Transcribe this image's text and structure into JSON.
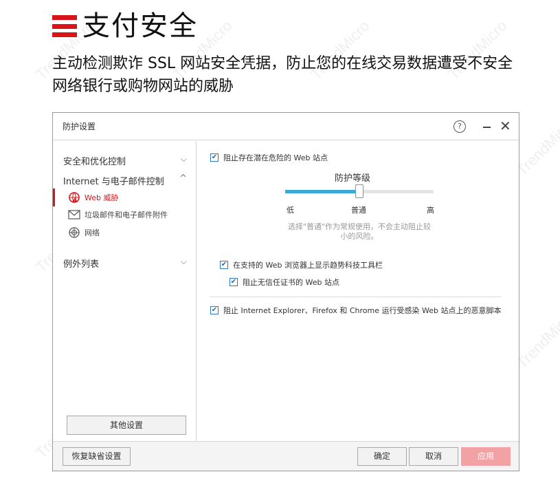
{
  "hero": {
    "title": "支付安全",
    "subtitle": "主动检测欺诈 SSL 网站安全凭据，防止您的在线交易数据遭受不安全网络银行或购物网站的威胁"
  },
  "watermark": "TrendMicro",
  "dialog": {
    "title": "防护设置",
    "help_icon": "?",
    "minimize_icon": "minimize-icon",
    "close_glyph": "✕"
  },
  "sidebar": {
    "security": "安全和优化控制",
    "internet_email": "Internet 与电子邮件控制",
    "web_threats": "Web 威胁",
    "spam": "垃圾邮件和电子邮件附件",
    "network": "网络",
    "exceptions": "例外列表",
    "other_settings": "其他设置",
    "chev_down": "⌵",
    "chev_up": "^"
  },
  "main": {
    "block_dangerous": "阻止存在潜在危险的 Web 站点",
    "level_title": "防护等级",
    "level_value_percent": 50,
    "level_low": "低",
    "level_normal": "普通",
    "level_high": "高",
    "level_desc": "选择\"普通\"作为常规使用，不会主动阻止较小的风险。",
    "toolbar": "在支持的 Web 浏览器上显示趋势科技工具栏",
    "untrusted_cert": "阻止无信任证书的 Web 站点",
    "malicious_scripts": "阻止 Internet Explorer、Firefox 和 Chrome 运行受感染 Web 站点上的恶意脚本"
  },
  "footer": {
    "restore": "恢复缺省设置",
    "ok": "确定",
    "cancel": "取消",
    "apply": "应用"
  },
  "colors": {
    "brand_red": "#d7141a",
    "slider_blue": "#39a9d7",
    "apply_disabled": "#f2a2a5"
  }
}
